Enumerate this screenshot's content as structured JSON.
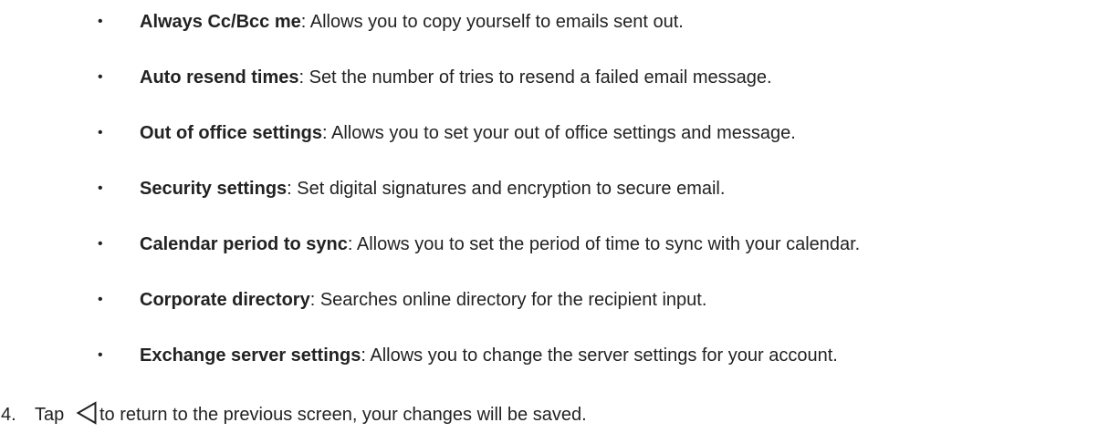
{
  "settings_list": [
    {
      "term": "Always Cc/Bcc me",
      "description": ": Allows you to copy yourself to emails sent out."
    },
    {
      "term": "Auto resend times",
      "description": ": Set the number of tries to resend a failed email message."
    },
    {
      "term": "Out of office settings",
      "description": ": Allows you to set your out of office settings and message."
    },
    {
      "term": "Security settings",
      "description": ": Set digital signatures and encryption to secure email."
    },
    {
      "term": "Calendar period to sync",
      "description": ": Allows you to set the period of time to sync with your calendar."
    },
    {
      "term": "Corporate directory",
      "description": ": Searches online directory for the recipient input."
    },
    {
      "term": "Exchange server settings",
      "description": ": Allows you to change the server settings for your account."
    }
  ],
  "bullet_symbol": "•",
  "step": {
    "number": "4.",
    "prefix": "Tap",
    "icon": "back-triangle-icon",
    "suffix": "to return to the previous screen, your changes will be saved."
  }
}
